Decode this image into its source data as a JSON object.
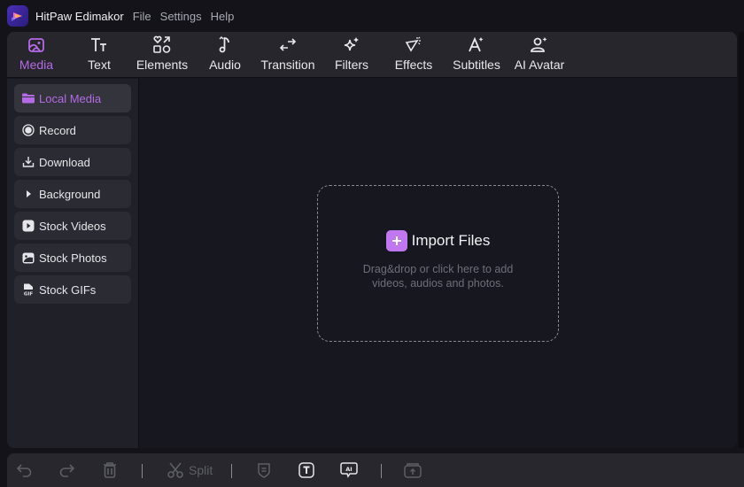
{
  "app": {
    "title": "HitPaw Edimakor",
    "menu": [
      "File",
      "Settings",
      "Help"
    ]
  },
  "toolbar": {
    "tabs": [
      {
        "label": "Media",
        "icon": "media-icon",
        "active": true
      },
      {
        "label": "Text",
        "icon": "text-icon",
        "active": false
      },
      {
        "label": "Elements",
        "icon": "elements-icon",
        "active": false
      },
      {
        "label": "Audio",
        "icon": "audio-icon",
        "active": false
      },
      {
        "label": "Transition",
        "icon": "transition-icon",
        "active": false
      },
      {
        "label": "Filters",
        "icon": "filters-icon",
        "active": false
      },
      {
        "label": "Effects",
        "icon": "effects-icon",
        "active": false
      },
      {
        "label": "Subtitles",
        "icon": "subtitles-icon",
        "active": false
      },
      {
        "label": "AI Avatar",
        "icon": "ai-avatar-icon",
        "active": false
      }
    ]
  },
  "sidebar": {
    "items": [
      {
        "label": "Local Media",
        "icon": "folder-icon",
        "active": true
      },
      {
        "label": "Record",
        "icon": "record-icon",
        "active": false
      },
      {
        "label": "Download",
        "icon": "download-icon",
        "active": false
      },
      {
        "label": "Background",
        "icon": "play-triangle-icon",
        "active": false
      },
      {
        "label": "Stock Videos",
        "icon": "video-icon",
        "active": false
      },
      {
        "label": "Stock Photos",
        "icon": "photo-icon",
        "active": false
      },
      {
        "label": "Stock GIFs",
        "icon": "gif-icon",
        "active": false
      }
    ]
  },
  "dropzone": {
    "title": "Import Files",
    "hint_line1": "Drag&drop or click here to add",
    "hint_line2": "videos, audios and photos."
  },
  "bottombar": {
    "split_label": "Split",
    "icons": [
      "undo-icon",
      "redo-icon",
      "delete-icon",
      "split-icon",
      "shield-icon",
      "text-box-icon",
      "ai-chat-icon",
      "export-icon"
    ]
  },
  "colors": {
    "accent": "#b56ae6",
    "import_button": "#c077f0",
    "background": "#16171f",
    "toolbar": "#26262c"
  }
}
